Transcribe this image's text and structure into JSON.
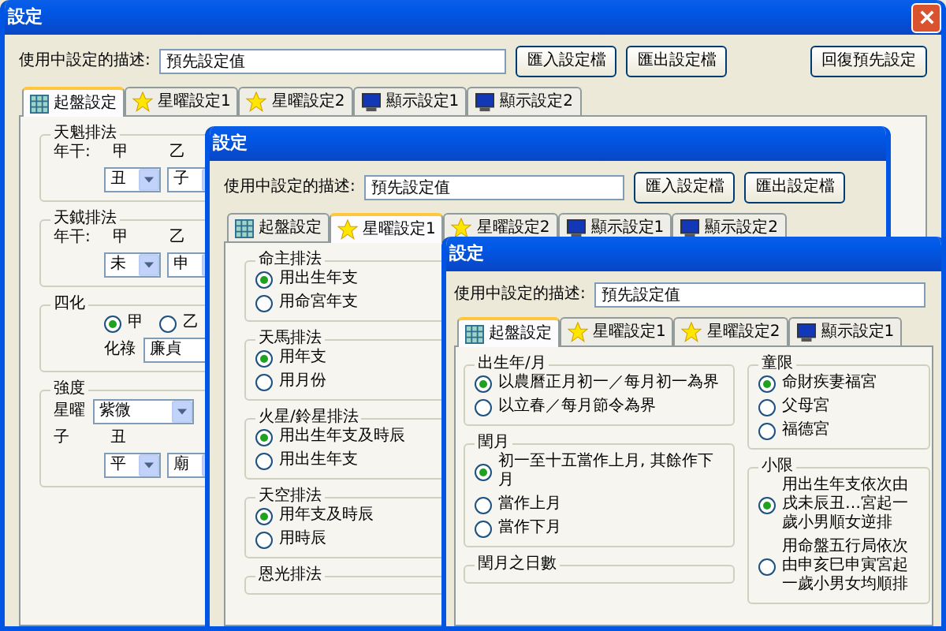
{
  "windows": [
    {
      "title": "設定",
      "close_button": true,
      "description_label": "使用中設定的描述:",
      "description_value": "預先設定值",
      "buttons": [
        "匯入設定檔",
        "匯出設定檔"
      ],
      "reset_button": "回復預先設定",
      "tabs": [
        {
          "label": "起盤設定",
          "kind": "layout",
          "selected": true
        },
        {
          "label": "星曜設定1",
          "kind": "stars",
          "selected": false
        },
        {
          "label": "星曜設定2",
          "kind": "stars",
          "selected": false
        },
        {
          "label": "顯示設定1",
          "kind": "display",
          "selected": false
        },
        {
          "label": "顯示設定2",
          "kind": "display",
          "selected": false
        }
      ],
      "columns": [
        [
          {
            "title": "天魁排法",
            "rows": [
              {
                "kind": "labels",
                "cells": [
                  "年干:",
                  "甲",
                  "乙"
                ]
              },
              {
                "kind": "dropdowns",
                "values": [
                  "丑",
                  "子"
                ]
              }
            ]
          },
          {
            "title": "天鉞排法",
            "rows": [
              {
                "kind": "labels",
                "cells": [
                  "年干:",
                  "甲",
                  "乙"
                ]
              },
              {
                "kind": "dropdowns",
                "values": [
                  "未",
                  "申"
                ]
              }
            ]
          },
          {
            "title": "四化",
            "rows": [
              {
                "kind": "radio_row",
                "options": [
                  {
                    "label": "甲",
                    "selected": true
                  },
                  {
                    "label": "乙",
                    "selected": false
                  }
                ]
              },
              {
                "kind": "field",
                "label": "化祿",
                "value": "廉貞"
              }
            ]
          },
          {
            "title": "強度",
            "rows": [
              {
                "kind": "select",
                "label": "星曜",
                "value": "紫微"
              },
              {
                "kind": "labels",
                "cells": [
                  "子",
                  "丑"
                ]
              },
              {
                "kind": "dropdowns",
                "values": [
                  "平",
                  "廟"
                ]
              }
            ]
          }
        ]
      ]
    },
    {
      "title": "設定",
      "description_label": "使用中設定的描述:",
      "description_value": "預先設定值",
      "buttons": [
        "匯入設定檔",
        "匯出設定檔"
      ],
      "tabs": [
        {
          "label": "起盤設定",
          "kind": "layout",
          "selected": false
        },
        {
          "label": "星曜設定1",
          "kind": "stars",
          "selected": true
        },
        {
          "label": "星曜設定2",
          "kind": "stars",
          "selected": false
        },
        {
          "label": "顯示設定1",
          "kind": "display",
          "selected": false
        },
        {
          "label": "顯示設定2",
          "kind": "display",
          "selected": false
        }
      ],
      "columns": [
        [
          {
            "title": "命主排法",
            "rows": [
              {
                "kind": "radio",
                "label": "用出生年支",
                "selected": true
              },
              {
                "kind": "radio",
                "label": "用命宮年支",
                "selected": false
              }
            ]
          },
          {
            "title": "天馬排法",
            "rows": [
              {
                "kind": "radio",
                "label": "用年支",
                "selected": true
              },
              {
                "kind": "radio",
                "label": "用月份",
                "selected": false
              }
            ]
          },
          {
            "title": "火星/鈴星排法",
            "rows": [
              {
                "kind": "radio",
                "label": "用出生年支及時辰",
                "selected": true
              },
              {
                "kind": "radio",
                "label": "用出生年支",
                "selected": false
              }
            ]
          },
          {
            "title": "天空排法",
            "rows": [
              {
                "kind": "radio",
                "label": "用年支及時辰",
                "selected": true
              },
              {
                "kind": "radio",
                "label": "用時辰",
                "selected": false
              }
            ]
          },
          {
            "title": "恩光排法"
          }
        ]
      ]
    },
    {
      "title": "設定",
      "description_label": "使用中設定的描述:",
      "description_value": "預先設定值",
      "tabs": [
        {
          "label": "起盤設定",
          "kind": "layout",
          "selected": true
        },
        {
          "label": "星曜設定1",
          "kind": "stars",
          "selected": false
        },
        {
          "label": "星曜設定2",
          "kind": "stars",
          "selected": false
        },
        {
          "label": "顯示設定1",
          "kind": "display",
          "selected": false
        }
      ],
      "columns": [
        [
          {
            "title": "出生年/月",
            "rows": [
              {
                "kind": "radio",
                "label": "以農曆正月初一／每月初一為界",
                "selected": true
              },
              {
                "kind": "radio",
                "label": "以立春／每月節令為界",
                "selected": false
              }
            ]
          },
          {
            "title": "閏月",
            "rows": [
              {
                "kind": "radio",
                "label": "初一至十五當作上月, 其餘作下月",
                "selected": true
              },
              {
                "kind": "radio",
                "label": "當作上月",
                "selected": false
              },
              {
                "kind": "radio",
                "label": "當作下月",
                "selected": false
              }
            ]
          },
          {
            "title": "閏月之日數"
          }
        ],
        [
          {
            "title": "童限",
            "rows": [
              {
                "kind": "radio",
                "label": "命財疾妻福宮",
                "selected": true
              },
              {
                "kind": "radio",
                "label": "父母宮",
                "selected": false
              },
              {
                "kind": "radio",
                "label": "福德宮",
                "selected": false
              }
            ]
          },
          {
            "title": "小限",
            "rows": [
              {
                "kind": "radio",
                "label": "用出生年支依次由戌未辰丑…宮起一歲小男順女逆排",
                "selected": true
              },
              {
                "kind": "radio",
                "label": "用命盤五行局依次由申亥巳申寅宮起一歲小男女均順排",
                "selected": false
              }
            ]
          }
        ]
      ]
    }
  ]
}
